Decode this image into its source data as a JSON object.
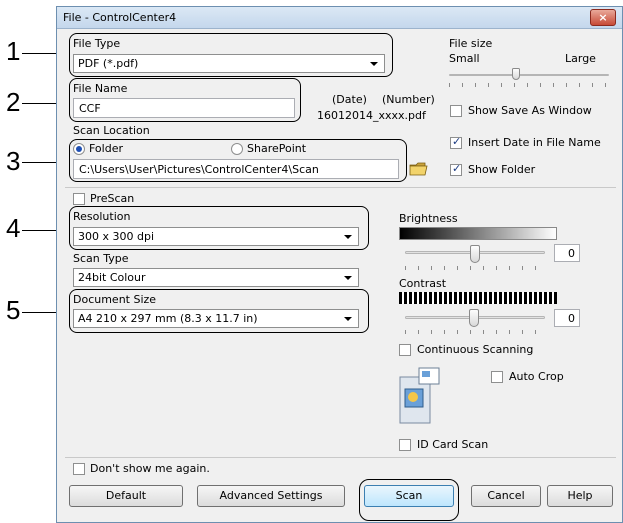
{
  "callouts": [
    "1",
    "2",
    "3",
    "4",
    "5"
  ],
  "window": {
    "title": "File - ControlCenter4",
    "close_label": "×"
  },
  "file_type": {
    "label": "File Type",
    "value": "PDF (*.pdf)"
  },
  "file_size": {
    "label": "File size",
    "small": "Small",
    "large": "Large"
  },
  "file_name": {
    "label": "File Name",
    "value": "CCF",
    "date_label": "(Date)",
    "number_label": "(Number)",
    "preview": "16012014_xxxx.pdf"
  },
  "show_save_as": {
    "label": "Show Save As Window",
    "checked": false
  },
  "scan_location": {
    "label": "Scan Location",
    "folder": "Folder",
    "sharepoint": "SharePoint",
    "path": "C:\\Users\\User\\Pictures\\ControlCenter4\\Scan"
  },
  "insert_date": {
    "label": "Insert Date in File Name",
    "checked": true
  },
  "show_folder": {
    "label": "Show Folder",
    "checked": true
  },
  "prescan": {
    "label": "PreScan",
    "checked": false
  },
  "resolution": {
    "label": "Resolution",
    "value": "300 x 300 dpi"
  },
  "scan_type": {
    "label": "Scan Type",
    "value": "24bit Colour"
  },
  "document_size": {
    "label": "Document Size",
    "value": "A4 210 x 297 mm (8.3 x 11.7 in)"
  },
  "brightness": {
    "label": "Brightness",
    "value": "0"
  },
  "contrast": {
    "label": "Contrast",
    "value": "0"
  },
  "continuous_scanning": {
    "label": "Continuous Scanning",
    "checked": false
  },
  "auto_crop": {
    "label": "Auto Crop",
    "checked": false
  },
  "id_card_scan": {
    "label": "ID Card Scan",
    "checked": false
  },
  "dont_show": {
    "label": "Don't show me again.",
    "checked": false
  },
  "buttons": {
    "default": "Default",
    "advanced": "Advanced Settings",
    "scan": "Scan",
    "cancel": "Cancel",
    "help": "Help"
  },
  "icons": {
    "folder": "folder-browse-icon",
    "autocrop": "auto-crop-preview-icon"
  }
}
